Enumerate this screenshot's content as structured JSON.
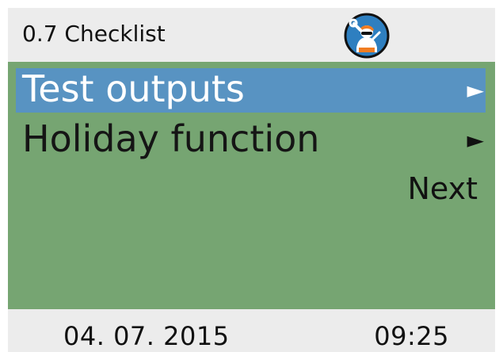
{
  "header": {
    "title": "0.7 Checklist",
    "avatar_icon": "service-technician-icon"
  },
  "menu": {
    "items": [
      {
        "label": "Test outputs",
        "arrow": "►",
        "selected": true
      },
      {
        "label": "Holiday function",
        "arrow": "►",
        "selected": false
      }
    ],
    "next_label": "Next"
  },
  "footer": {
    "date": "04. 07. 2015",
    "time": "09:25"
  },
  "colors": {
    "header_bg": "#ececec",
    "main_bg": "#76a572",
    "selected_bg": "#5893c2",
    "footer_bg": "#ececec",
    "icon_blue": "#2e7fc0",
    "icon_orange": "#f07d22"
  }
}
